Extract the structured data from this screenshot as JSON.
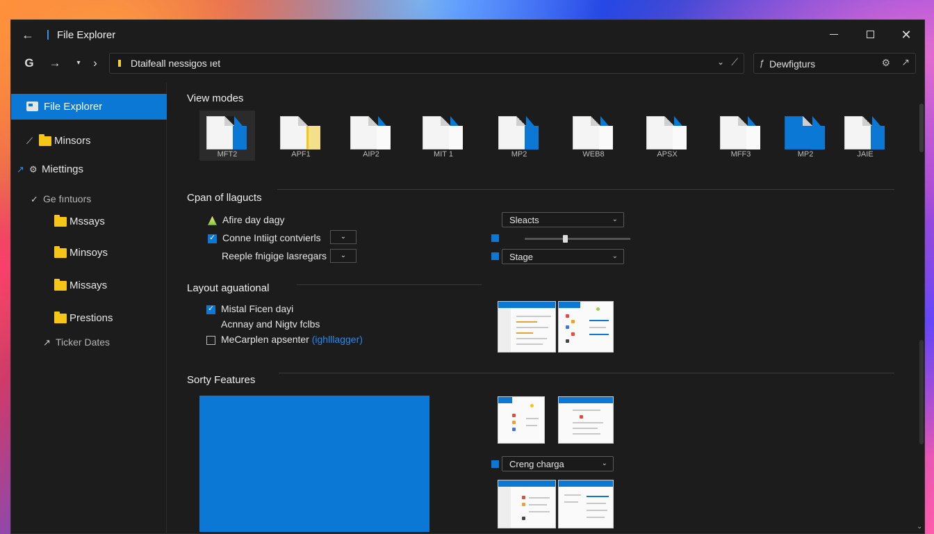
{
  "window": {
    "title": "File Explorer"
  },
  "address": {
    "path": "Dtaifeall nessigos ıet"
  },
  "search": {
    "text": "Dewfigturs"
  },
  "sidebar": {
    "active_label": "File Explorer",
    "items": [
      {
        "label": "Minsors",
        "icon": "folder-icon"
      },
      {
        "label": "Miettings",
        "icon": "settings-icon"
      },
      {
        "label": "Ge fıntuors",
        "icon": "chevron-icon"
      },
      {
        "label": "Mssays",
        "icon": "folder-icon"
      },
      {
        "label": "Minsoys",
        "icon": "folder-icon"
      },
      {
        "label": "Missays",
        "icon": "folder-icon"
      },
      {
        "label": "Prestions",
        "icon": "folder-icon"
      },
      {
        "label": "Ticker Dates",
        "icon": "arrow-icon"
      }
    ]
  },
  "view_modes": {
    "title": "View modes",
    "tiles": [
      "MFT2",
      "APF1",
      "AIP2",
      "MIT 1",
      "MP2",
      "WEB8",
      "APSX",
      "MFF3",
      "MP2",
      "JAIE"
    ]
  },
  "options": {
    "title": "Cpan of llagucts",
    "rows": [
      {
        "label": "Afire day dagy"
      },
      {
        "label": "Conne Intiigt contvierls"
      },
      {
        "label": "Reeple fnigige lasregars"
      }
    ],
    "right_controls": {
      "dropdown1": "Sleacts",
      "dropdown2": "Stage",
      "slider_value": 0.38
    }
  },
  "layout": {
    "title": "Layout aguational",
    "rows": [
      {
        "label": "Mistal Ficen dayi"
      },
      {
        "label": "Acnnay and Nigtv fclbs"
      },
      {
        "label": "MeCarplen apsenter",
        "link": "(ighlllagger)"
      }
    ]
  },
  "sorty": {
    "title": "Sorty Features",
    "dropdown": "Creng charga"
  },
  "colors": {
    "accent": "#0a78d4",
    "background": "#1c1c1c",
    "folder": "#f5c518"
  }
}
